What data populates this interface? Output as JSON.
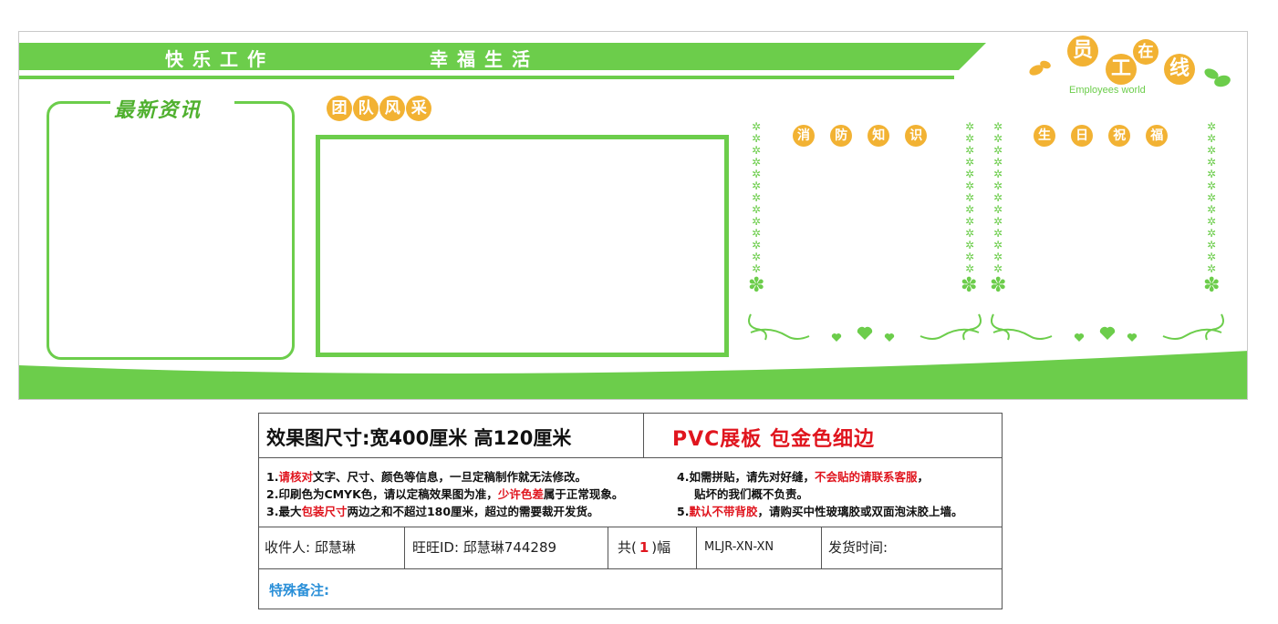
{
  "board": {
    "banner_left": "快乐工作",
    "banner_right": "幸福生活",
    "logo_chars": [
      "员",
      "工",
      "在",
      "线"
    ],
    "logo_sub": "Employees world",
    "news_title": "最新资讯",
    "team_chars": [
      "团",
      "队",
      "风",
      "采"
    ],
    "fire_chars": [
      "消",
      "防",
      "知",
      "识"
    ],
    "birthday_chars": [
      "生",
      "日",
      "祝",
      "福"
    ],
    "colors": {
      "green": "#6ccd4b",
      "orange": "#f2b233"
    }
  },
  "spec": {
    "size_label": "效果图尺寸:宽400厘米  高120厘米",
    "material": "PVC展板 包金色细边",
    "notes": {
      "n1_a": "1.",
      "n1_red": "请核对",
      "n1_b": "文字、尺寸、颜色等信息，一旦定稿制作就无法修改。",
      "n2_a": "2.印刷色为CMYK色，请以定稿效果图为准，",
      "n2_red": "少许色差",
      "n2_b": "属于正常现象。",
      "n3_a": "3.最大",
      "n3_red": "包装尺寸",
      "n3_b": "两边之和不超过180厘米，超过的需要裁开发货。",
      "n4_a": "4.如需拼贴，请先对好缝，",
      "n4_red": "不会贴的请联系客服",
      "n4_b": "，",
      "n4_line2": "贴坏的我们概不负责。",
      "n5_a": "5.",
      "n5_red": "默认不带背胶",
      "n5_b": "，请购买中性玻璃胶或双面泡沫胶上墙。"
    },
    "recipient": "收件人: 邱慧琳",
    "wangwang": "旺旺ID:  邱慧琳744289",
    "count_a": "共(",
    "count_num": "1",
    "count_b": ")幅",
    "code": "MLJR-XN-XN",
    "ship_time": "发货时间:",
    "remark": "特殊备注:"
  }
}
